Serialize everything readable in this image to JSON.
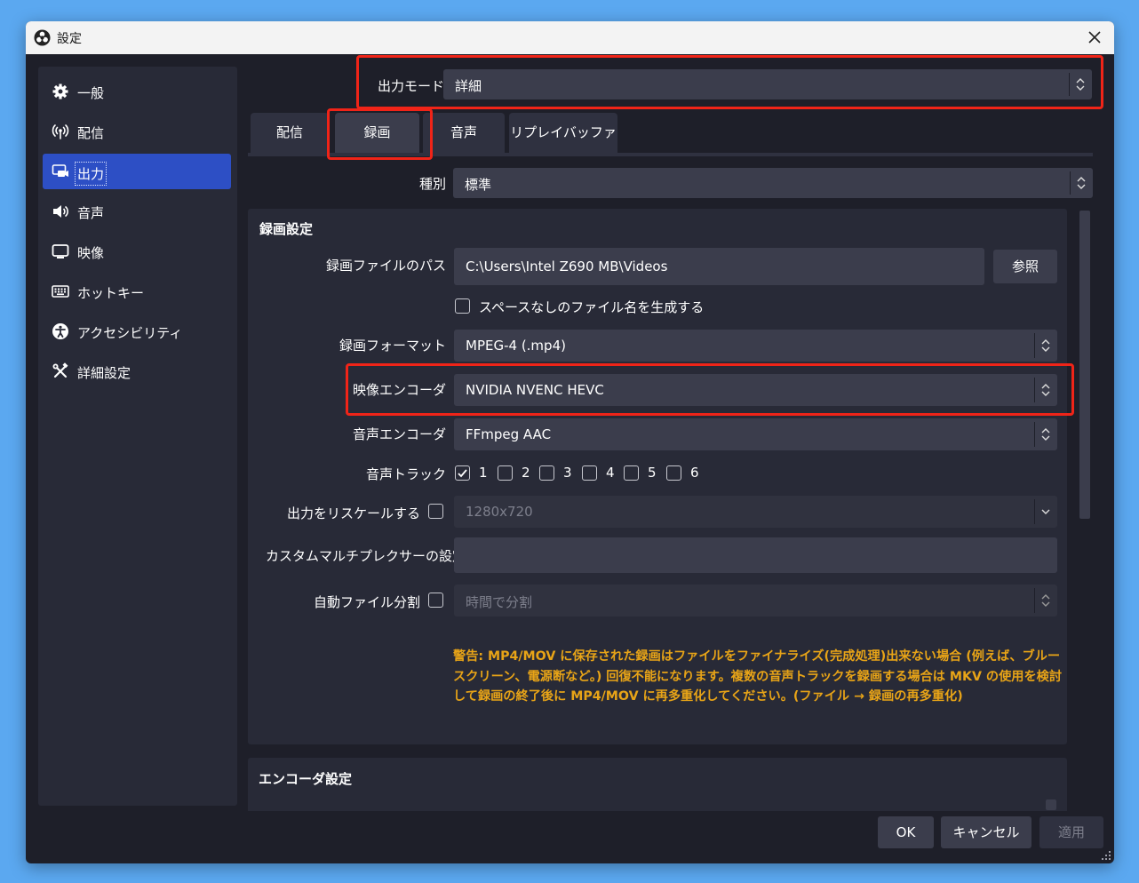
{
  "window": {
    "title": "設定",
    "close_icon": "close-icon"
  },
  "sidebar": {
    "items": [
      {
        "label": "一般",
        "icon": "gear-icon"
      },
      {
        "label": "配信",
        "icon": "broadcast-icon"
      },
      {
        "label": "出力",
        "icon": "output-icon",
        "active": true
      },
      {
        "label": "音声",
        "icon": "speaker-icon"
      },
      {
        "label": "映像",
        "icon": "monitor-icon"
      },
      {
        "label": "ホットキー",
        "icon": "keyboard-icon"
      },
      {
        "label": "アクセシビリティ",
        "icon": "accessibility-icon"
      },
      {
        "label": "詳細設定",
        "icon": "tools-icon"
      }
    ]
  },
  "output_mode": {
    "label": "出力モード",
    "value": "詳細"
  },
  "tabs": [
    {
      "label": "配信"
    },
    {
      "label": "録画",
      "active": true
    },
    {
      "label": "音声"
    },
    {
      "label": "リプレイバッファ"
    }
  ],
  "type": {
    "label": "種別",
    "value": "標準"
  },
  "recording_settings": {
    "title": "録画設定",
    "path_label": "録画ファイルのパス",
    "path_value": "C:\\Users\\Intel Z690 MB\\Videos",
    "browse_label": "参照",
    "no_space_label": "スペースなしのファイル名を生成する",
    "format_label": "録画フォーマット",
    "format_value": "MPEG-4 (.mp4)",
    "video_encoder_label": "映像エンコーダ",
    "video_encoder_value": "NVIDIA NVENC HEVC",
    "audio_encoder_label": "音声エンコーダ",
    "audio_encoder_value": "FFmpeg AAC",
    "audio_track_label": "音声トラック",
    "tracks": [
      "1",
      "2",
      "3",
      "4",
      "5",
      "6"
    ],
    "tracks_checked": [
      true,
      false,
      false,
      false,
      false,
      false
    ],
    "rescale_label": "出力をリスケールする",
    "rescale_value": "1280x720",
    "mux_label": "カスタムマルチプレクサーの設定",
    "mux_value": "",
    "split_label": "自動ファイル分割",
    "split_value": "時間で分割",
    "warning": "警告: MP4/MOV に保存された録画はファイルをファイナライズ(完成処理)出来ない場合 (例えば、ブルースクリーン、電源断など。) 回復不能になります。複数の音声トラックを録画する場合は MKV の使用を検討して録画の終了後に MP4/MOV に再多重化してください。(ファイル → 録画の再多重化)"
  },
  "encoder_settings": {
    "title": "エンコーダ設定"
  },
  "buttons": {
    "ok": "OK",
    "cancel": "キャンセル",
    "apply": "適用"
  },
  "colors": {
    "accent": "#2d4fc5",
    "warning": "#e8a417",
    "highlight": "#f02418",
    "background": "#1e1f29"
  }
}
